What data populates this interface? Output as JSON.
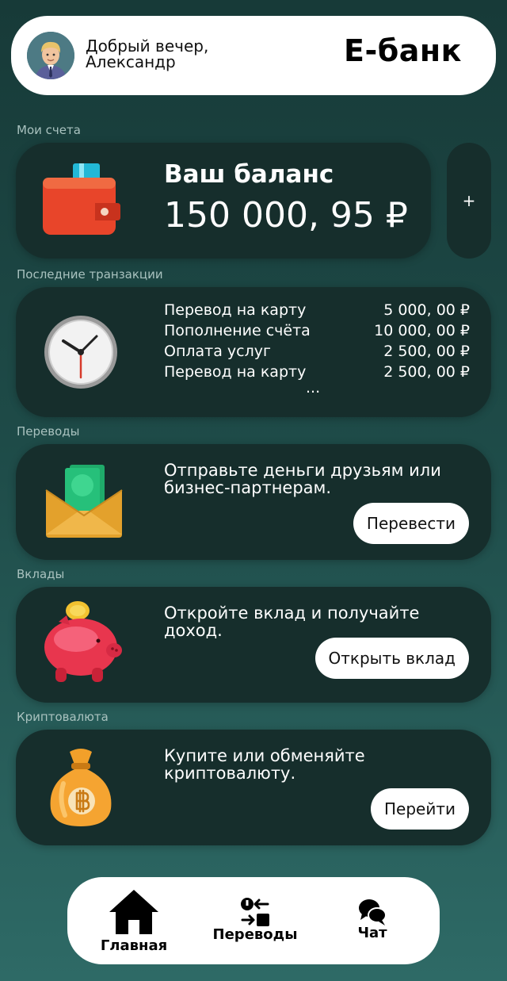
{
  "header": {
    "greeting_line1": "Добрый вечер,",
    "greeting_line2": "Александр",
    "brand": "E-банк",
    "avatar_icon": "user-avatar-icon"
  },
  "sections": {
    "accounts": "Мои счета",
    "transactions": "Последние транзакции",
    "transfers": "Переводы",
    "deposits": "Вклады",
    "crypto": "Криптовалюта"
  },
  "balance": {
    "title": "Ваш баланс",
    "amount": "150 000, 95 ₽",
    "add_label": "+",
    "icon": "wallet-icon"
  },
  "transactions": {
    "icon": "clock-icon",
    "items": [
      {
        "name": "Перевод на карту",
        "amount": "5 000, 00 ₽"
      },
      {
        "name": "Пополнение счёта",
        "amount": "10 000, 00 ₽"
      },
      {
        "name": "Оплата услуг",
        "amount": "2 500, 00 ₽"
      },
      {
        "name": "Перевод на карту",
        "amount": "2 500, 00 ₽"
      }
    ],
    "more": "..."
  },
  "transfers": {
    "text": "Отправьте деньги друзьям или бизнес-партнерам.",
    "button": "Перевести",
    "icon": "envelope-money-icon"
  },
  "deposits": {
    "text": "Откройте вклад и получайте доход.",
    "button": "Открыть вклад",
    "icon": "piggy-bank-icon"
  },
  "crypto": {
    "text": "Купите или обменяйте криптовалюту.",
    "button": "Перейти",
    "icon": "bitcoin-bag-icon"
  },
  "nav": {
    "home": "Главная",
    "transfers": "Переводы",
    "chat": "Чат"
  },
  "colors": {
    "card_bg": "#162e2c",
    "page_bg_top": "#173a38",
    "page_bg_bottom": "#2e6a66",
    "header_bg": "#ffffff"
  }
}
